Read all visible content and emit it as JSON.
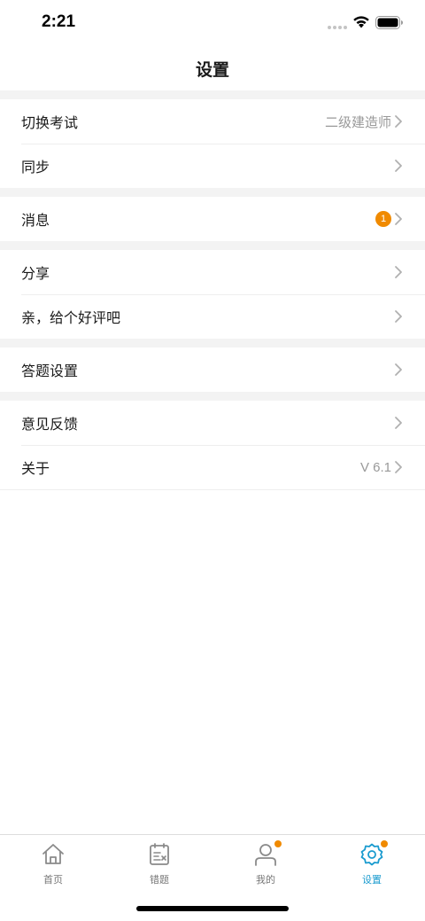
{
  "status": {
    "time": "2:21"
  },
  "nav": {
    "title": "设置"
  },
  "groups": {
    "exam": {
      "switch_label": "切换考试",
      "switch_value": "二级建造师",
      "sync_label": "同步"
    },
    "message": {
      "label": "消息",
      "badge": "1"
    },
    "share": {
      "share_label": "分享",
      "review_label": "亲，给个好评吧"
    },
    "answer": {
      "label": "答题设置"
    },
    "about": {
      "feedback_label": "意见反馈",
      "about_label": "关于",
      "version": "V 6.1"
    }
  },
  "tabs": [
    {
      "label": "首页",
      "icon": "home-icon"
    },
    {
      "label": "错题",
      "icon": "wrong-questions-icon"
    },
    {
      "label": "我的",
      "icon": "profile-icon"
    },
    {
      "label": "设置",
      "icon": "settings-gear-icon"
    }
  ],
  "colors": {
    "accent": "#1a9bcf",
    "badge": "#f08a00"
  }
}
